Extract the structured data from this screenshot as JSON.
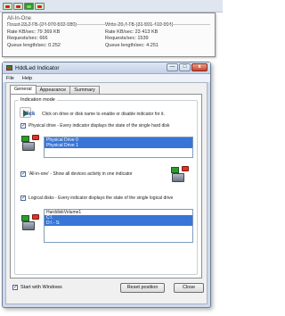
{
  "tooltip": {
    "title": "All-In-One",
    "rows": [
      [
        "React 23,2 ГБ (24 979 502 080)",
        "Write 29,4 ГБ (31 591 419 904)"
      ],
      [
        "Rate KB/sec: 79 369 KB",
        "Rate KB/sec: 23 413 KB"
      ],
      [
        "Requests/sec: 666",
        "Requests/sec: 1539"
      ],
      [
        "Queue length/sec: 0.252",
        "Queue length/sec: 4.251"
      ]
    ]
  },
  "window": {
    "title": "HddLed Indicator",
    "controls": {
      "minimize": "—",
      "maximize": "□",
      "close": "x"
    },
    "menu": [
      "File",
      "Help"
    ],
    "tabs": [
      "General",
      "Appearance",
      "Summary"
    ],
    "group_label": "Indication mode",
    "click_word": "click",
    "click_desc": "Click on drive or disk name to enable or disable indicator for it.",
    "physical": {
      "label": "Physical drive - Every indicator displays the state of the single hard disk",
      "items": [
        "Physical Drive 0",
        "Physical Drive 1"
      ]
    },
    "allinone": {
      "label": "'All-in-one' - Show all devices activity in one indicator"
    },
    "logical": {
      "label": "Logical disks - Every indicator displays the state of the single logical drive",
      "items": [
        "HarddiskVolume1",
        "C:\\",
        "D:\\ - S:"
      ]
    },
    "start_with_windows": "Start with Windows",
    "reset_button": "Reset position",
    "close_button": "Close"
  },
  "colors": {
    "selection": "#3875d7",
    "led_red": "#e3322a",
    "led_green": "#2e9a2e"
  }
}
